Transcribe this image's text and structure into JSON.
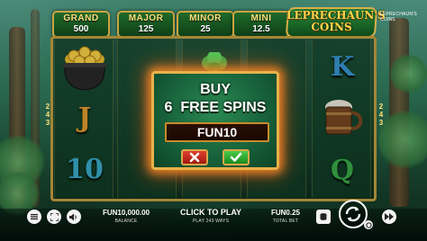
{
  "jackpots": [
    {
      "label": "GRAND",
      "value": "500"
    },
    {
      "label": "MAJOR",
      "value": "125"
    },
    {
      "label": "MINOR",
      "value": "25"
    },
    {
      "label": "MINI",
      "value": "12.5"
    }
  ],
  "logo": {
    "title_line1": "LEPRECHAUN'S",
    "title_line2": "COINS",
    "brand_caption": "LEPRECHAUN'S COINS"
  },
  "ways": {
    "left": [
      "2",
      "4",
      "3"
    ],
    "right": [
      "2",
      "4",
      "3"
    ]
  },
  "reels": {
    "reel1": [
      "pot-of-gold",
      "J",
      "10"
    ],
    "reel5": [
      "K",
      "ale-mug",
      "Q"
    ]
  },
  "modal": {
    "title": "BUY",
    "spins": "6  FREE SPINS",
    "price": "FUN10",
    "cancel_icon": "close-icon",
    "confirm_icon": "check-icon"
  },
  "footer": {
    "balance_value": "FUN10,000.00",
    "balance_label": "BALANCE",
    "click_to_play": "CLICK TO PLAY",
    "ways_text": "PLAY 243 WAYS",
    "bet_value": "FUN0.25",
    "bet_label": "TOTAL BET"
  },
  "colors": {
    "gold": "#c9a441",
    "felt": "#17603a",
    "cancel": "#e04030",
    "confirm": "#3aaa3a"
  }
}
